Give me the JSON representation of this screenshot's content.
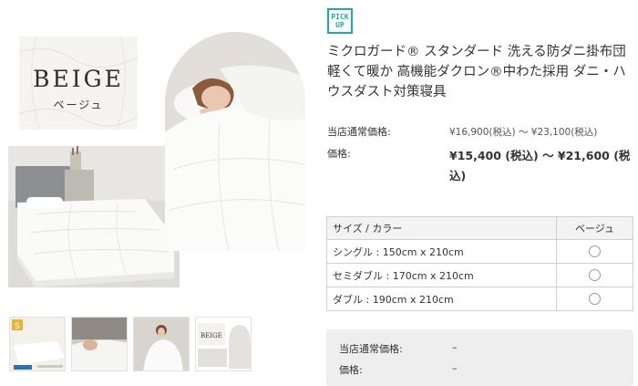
{
  "gallery": {
    "beige_word": "BEIGE",
    "beige_kana": "ベージュ",
    "thumbnails": [
      {
        "label": "S"
      },
      {
        "label": ""
      },
      {
        "label": ""
      },
      {
        "label": "BEIGE"
      }
    ]
  },
  "product": {
    "badge_line1": "PICK",
    "badge_line2": "UP",
    "title": "ミクロガード® スタンダード 洗える防ダニ掛布団 軽くて暖か 高機能ダクロン®中わた採用 ダニ・ハウスダスト対策寝具"
  },
  "prices": {
    "regular_label": "当店通常価格:",
    "regular_value": "¥16,900(税込) 〜 ¥23,100(税込)",
    "sale_label": "価格:",
    "sale_value": "¥15,400 (税込) 〜 ¥21,600 (税込)"
  },
  "variants": {
    "header_size": "サイズ / カラー",
    "header_color": "ベージュ",
    "rows": [
      {
        "label": "シングル : 150cm x 210cm"
      },
      {
        "label": "セミダブル : 170cm x 210cm"
      },
      {
        "label": "ダブル : 190cm x 210cm"
      }
    ]
  },
  "summary": {
    "regular_label": "当店通常価格:",
    "regular_value": "–",
    "price_label": "価格:",
    "price_value": "–"
  },
  "colors": {
    "accent": "#22a9a0",
    "table_header_bg": "#f3f3f3",
    "summary_bg": "#eeeeee"
  }
}
